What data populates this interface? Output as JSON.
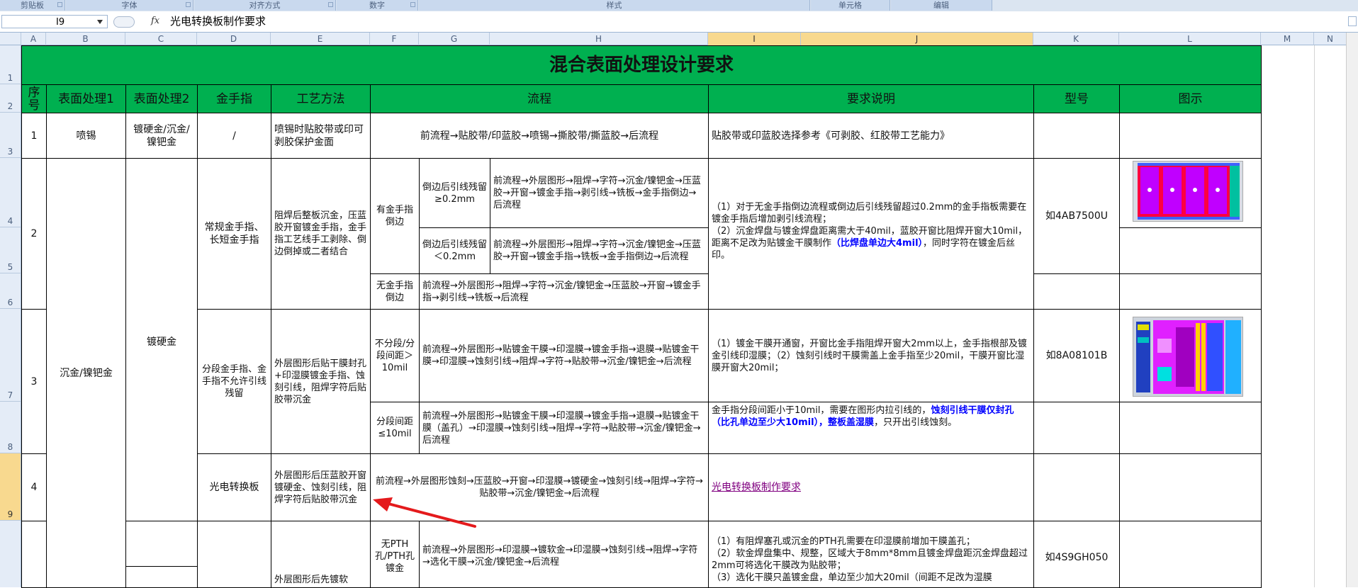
{
  "ribbon": {
    "groups": [
      "剪贴板",
      "字体",
      "对齐方式",
      "数字",
      "样式",
      "单元格",
      "编辑"
    ]
  },
  "formula_bar": {
    "name_box": "I9",
    "fx_label": "fx",
    "content": "光电转换板制作要求"
  },
  "columns": [
    "A",
    "B",
    "C",
    "D",
    "E",
    "F",
    "G",
    "H",
    "I",
    "J",
    "K",
    "L",
    "M",
    "N"
  ],
  "selected_columns": [
    "I",
    "J"
  ],
  "rows": [
    "1",
    "2",
    "3",
    "4",
    "5",
    "6",
    "7",
    "8",
    "9"
  ],
  "selected_row": "9",
  "sheet": {
    "title": "混合表面处理设计要求",
    "headers": {
      "seq": "序号",
      "surface1": "表面处理1",
      "surface2": "表面处理2",
      "gold_finger": "金手指",
      "process_method": "工艺方法",
      "flow": "流程",
      "requirement": "要求说明",
      "model": "型号",
      "diagram": "图示"
    },
    "r1": {
      "seq": "1",
      "surface1": "喷锡",
      "surface2": "镀硬金/沉金/镍钯金",
      "gold_finger": "/",
      "method": "喷锡时贴胶带或印可剥胶保护金面",
      "flow": "前流程→贴胶带/印蓝胶→喷锡→撕胶带/撕蓝胶→后流程",
      "requirement": "贴胶带或印蓝胶选择参考《可剥胶、红胶带工艺能力》"
    },
    "merged_surface1": "沉金/镍钯金",
    "merged_surface2": "镀硬金",
    "r2": {
      "seq": "2",
      "gold_finger": "常规金手指、长短金手指",
      "method": "阻焊后整板沉金，压蓝胶开窗镀金手指，金手指工艺线手工剥除、倒边倒掉或二者结合",
      "sub_with": "有金手指倒边",
      "sub_a_cond": "倒边后引线残留≥0.2mm",
      "sub_a_flow": "前流程→外层图形→阻焊→字符→沉金/镍钯金→压蓝胶→开窗→镀金手指→剥引线→铣板→金手指倒边→后流程",
      "sub_b_cond": "倒边后引线残留＜0.2mm",
      "sub_b_flow": "前流程→外层图形→阻焊→字符→沉金/镍钯金→压蓝胶→开窗→镀金手指→铣板→金手指倒边→后流程",
      "sub_none": "无金手指倒边",
      "sub_none_flow": "前流程→外层图形→阻焊→字符→沉金/镍钯金→压蓝胶→开窗→镀金手指→剥引线→铣板→后流程",
      "req_line1": "（1）对于无金手指倒边流程或倒边后引线残留超过0.2mm的金手指板需要在镀金手指后增加剥引线流程；",
      "req_line2": "（2）沉金焊盘与镀金焊盘距离需大于40mil，蓝胶开窗比阻焊开窗大10mil，距离不足改为贴镀金干膜制作",
      "req_blue": "（比焊盘单边大4mil）",
      "req_tail": "，同时字符在镀金后丝印。",
      "model": "如4AB7500U"
    },
    "r3": {
      "seq": "3",
      "gold_finger": "分段金手指、金手指不允许引线残留",
      "method": "外层图形后贴干膜封孔+印湿膜镀金手指、蚀刻引线，阻焊字符后贴胶带沉金",
      "sub_a_cond": "不分段/分段间距＞10mil",
      "sub_a_flow": "前流程→外层图形→贴镀金干膜→印湿膜→镀金手指→退膜→贴镀金干膜→印湿膜→蚀刻引线→阻焊→字符→贴胶带→沉金/镍钯金→后流程",
      "sub_a_req": "（1）镀金干膜开通窗，开窗比金手指阻焊开窗大2mm以上，金手指根部及镀金引线印湿膜；（2）蚀刻引线时干膜需盖上金手指至少20mil，干膜开窗比湿膜开窗大20mil；",
      "sub_b_cond": "分段间距≤10mil",
      "sub_b_flow": "前流程→外层图形→贴镀金干膜→印湿膜→镀金手指→退膜→贴镀金干膜（盖孔）→印湿膜→蚀刻引线→阻焊→字符→贴胶带→沉金/镍钯金→后流程",
      "sub_b_req_pre": "金手指分段间距小于10mil，需要在图形内拉引线的，",
      "sub_b_req_blue": "蚀刻引线干膜仅封孔（比孔单边至少大10mil），整板盖湿膜",
      "sub_b_req_tail": "，只开出引线蚀刻。",
      "model": "如8A08101B"
    },
    "r4": {
      "seq": "4",
      "gold_finger": "光电转换板",
      "method": "外层图形后压蓝胶开窗镀硬金、蚀刻引线，阻焊字符后贴胶带沉金",
      "flow": "前流程→外层图形蚀刻→压蓝胶→开窗→印湿膜→镀硬金→蚀刻引线→阻焊→字符→贴胶带→沉金/镍钯金→后流程",
      "requirement_link": "光电转换板制作要求"
    },
    "r5": {
      "method": "外层图形后先镀软",
      "sub_cond": "无PTH孔/PTH孔镀金",
      "sub_flow": "前流程→外层图形→印湿膜→镀软金→印湿膜→蚀刻引线→阻焊→字符→选化干膜→沉金/镍钯金→后流程",
      "req_line1": "（1）有阻焊塞孔或沉金的PTH孔需要在印湿膜前增加干膜盖孔；",
      "req_line2": "（2）软金焊盘集中、规整，区域大于8mm*8mm且镀金焊盘距沉金焊盘超过2mm可将选化干膜改为贴胶带；",
      "req_line3": "（3）选化干膜只盖镀金盘，单边至少加大20mil（间距不足改为湿膜",
      "model": "如4S9GH050"
    }
  },
  "colors": {
    "header_green": "#00b050",
    "selected_header": "#f8d98f",
    "arrow_red": "#e41a1c",
    "blue_text": "#0000ff",
    "link_purple": "#800080"
  }
}
